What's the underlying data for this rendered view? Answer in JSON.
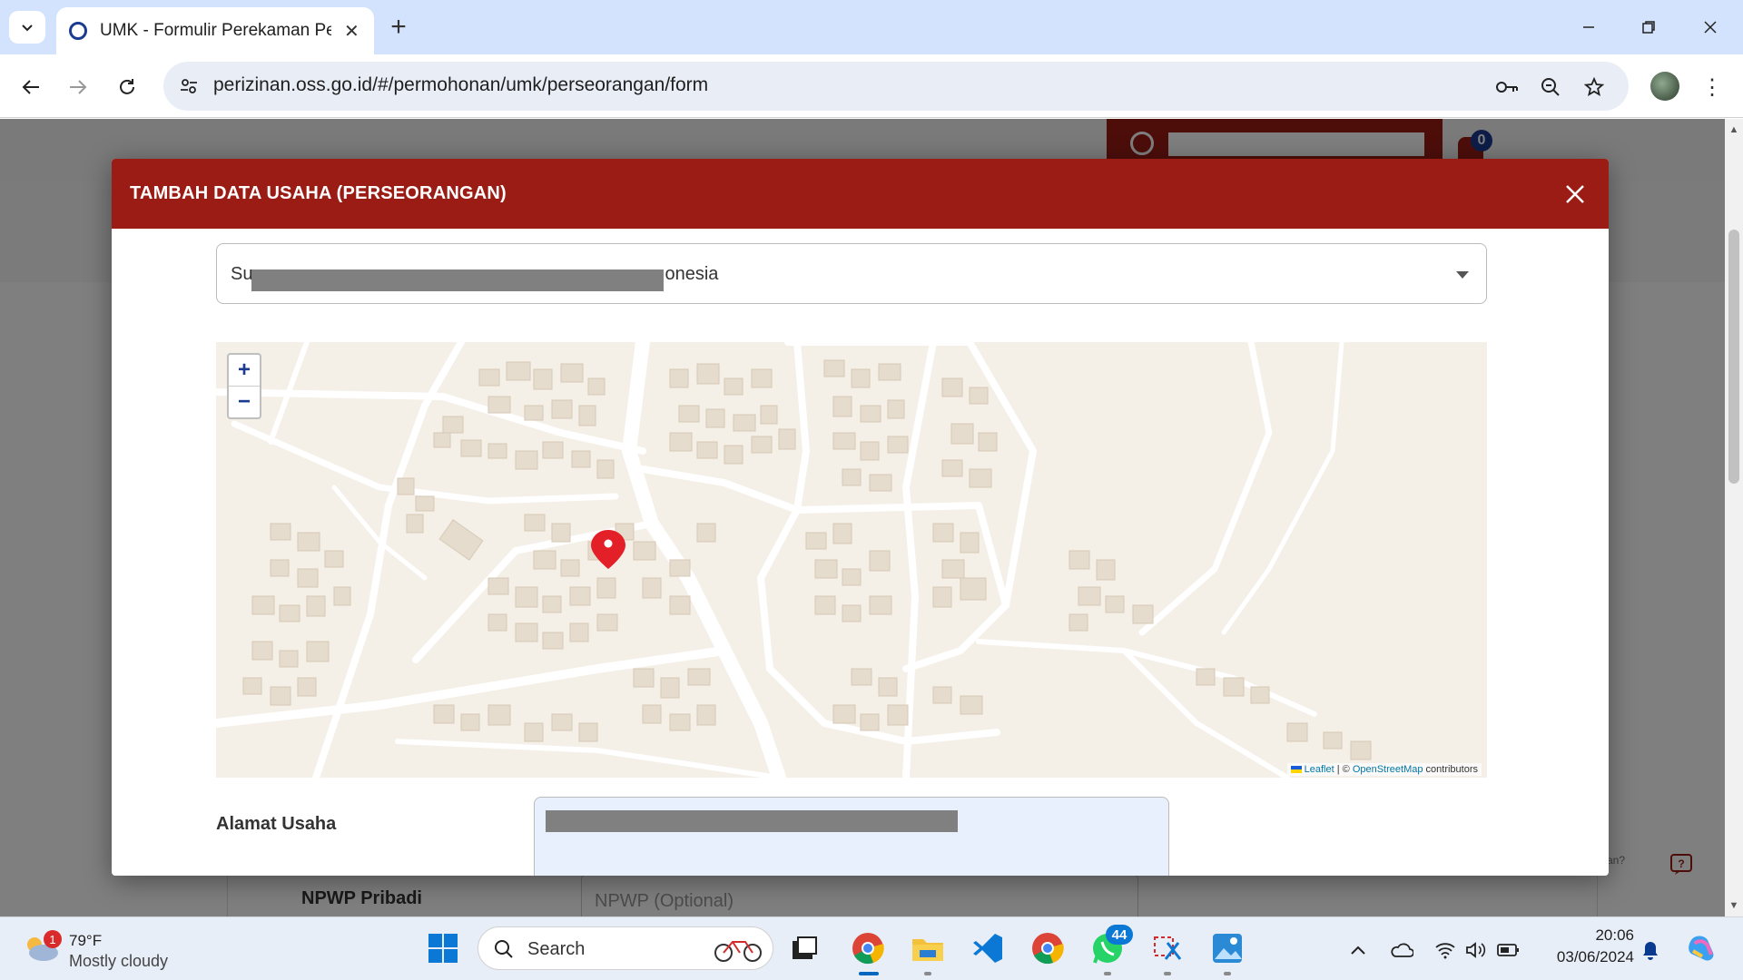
{
  "browser": {
    "tab_title": "UMK - Formulir Perekaman Pela",
    "url": "perizinan.oss.go.id/#/permohonan/umk/perseorangan/form"
  },
  "page": {
    "notification_count": "0",
    "npwp_label": "NPWP Pribadi",
    "npwp_placeholder": "NPWP (Optional)",
    "help_text": "an?"
  },
  "modal": {
    "title": "TAMBAH DATA USAHA (PERSEORANGAN)",
    "select_prefix": "Su",
    "select_suffix": "onesia",
    "map": {
      "zoom_in": "+",
      "zoom_out": "−",
      "attribution_leaflet": "Leaflet",
      "attribution_sep": " | © ",
      "attribution_osm": "OpenStreetMap",
      "attribution_tail": " contributors"
    },
    "alamat_label": "Alamat Usaha"
  },
  "taskbar": {
    "weather_badge": "1",
    "temperature": "79°F",
    "condition": "Mostly cloudy",
    "search_label": "Search",
    "whatsapp_badge": "44",
    "time": "20:06",
    "date": "03/06/2024"
  },
  "colors": {
    "brand_red": "#9b1c14",
    "map_bg": "#f4efe7",
    "taskbar_bg": "#e8eef7"
  }
}
